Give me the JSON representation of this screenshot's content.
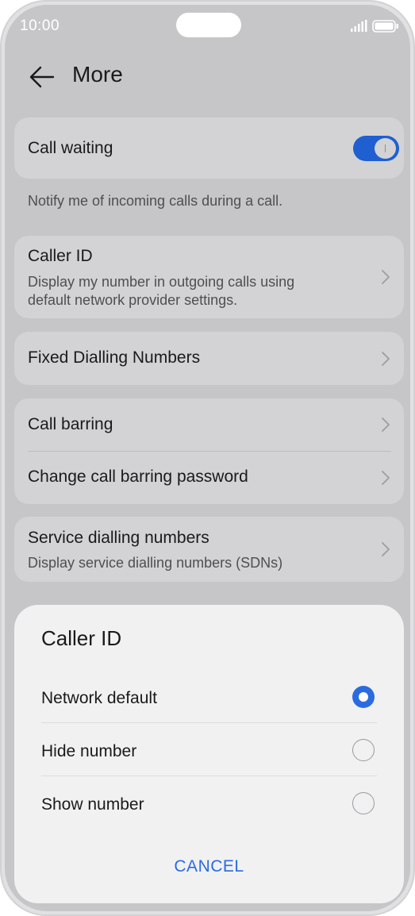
{
  "status_bar": {
    "time": "10:00"
  },
  "header": {
    "title": "More"
  },
  "call_waiting": {
    "label": "Call waiting",
    "enabled": true,
    "note": "Notify me of incoming calls during a call."
  },
  "caller_id_row": {
    "label": "Caller ID",
    "sub_line1": "Display my number in outgoing calls using",
    "sub_line2": "default network provider settings."
  },
  "fixed_dialling": {
    "label": "Fixed Dialling Numbers"
  },
  "call_barring": {
    "label": "Call barring",
    "change_password_label": "Change call barring password"
  },
  "service_dialling": {
    "label": "Service dialling numbers",
    "sub": "Display service dialling numbers (SDNs)"
  },
  "dialog": {
    "title": "Caller ID",
    "options": [
      {
        "label": "Network default",
        "selected": true
      },
      {
        "label": "Hide number",
        "selected": false
      },
      {
        "label": "Show number",
        "selected": false
      }
    ],
    "cancel_label": "CANCEL"
  },
  "colors": {
    "accent": "#2a6be0",
    "toggle_on": "#1f5fd0",
    "dim_background": "#c6c6c8",
    "card": "#d3d3d5",
    "sheet": "#f1f1f2"
  }
}
